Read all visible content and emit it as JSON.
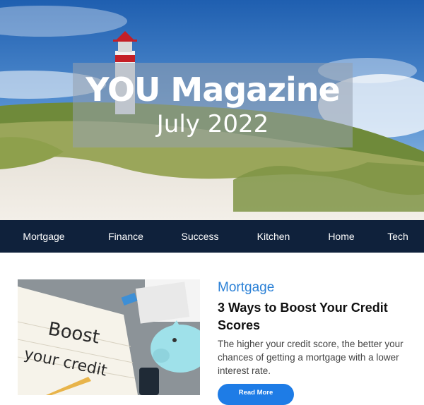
{
  "hero": {
    "title": "YOU Magazine",
    "subtitle": "July 2022"
  },
  "nav": {
    "items": [
      {
        "label": "Mortgage"
      },
      {
        "label": "Finance"
      },
      {
        "label": "Success"
      },
      {
        "label": "Kitchen"
      },
      {
        "label": "Home"
      },
      {
        "label": "Tech"
      }
    ]
  },
  "article": {
    "category": "Mortgage",
    "headline": "3 Ways to Boost Your Credit Scores",
    "summary": "The higher your credit score, the better your chances of getting a mortgage with a lower interest rate.",
    "button_label": "Read More",
    "image_text_line1": "Boost",
    "image_text_line2": "your credit"
  },
  "colors": {
    "nav_background": "#0f213b",
    "category_accent": "#2a80d6",
    "button_background": "#1e7ce6"
  }
}
